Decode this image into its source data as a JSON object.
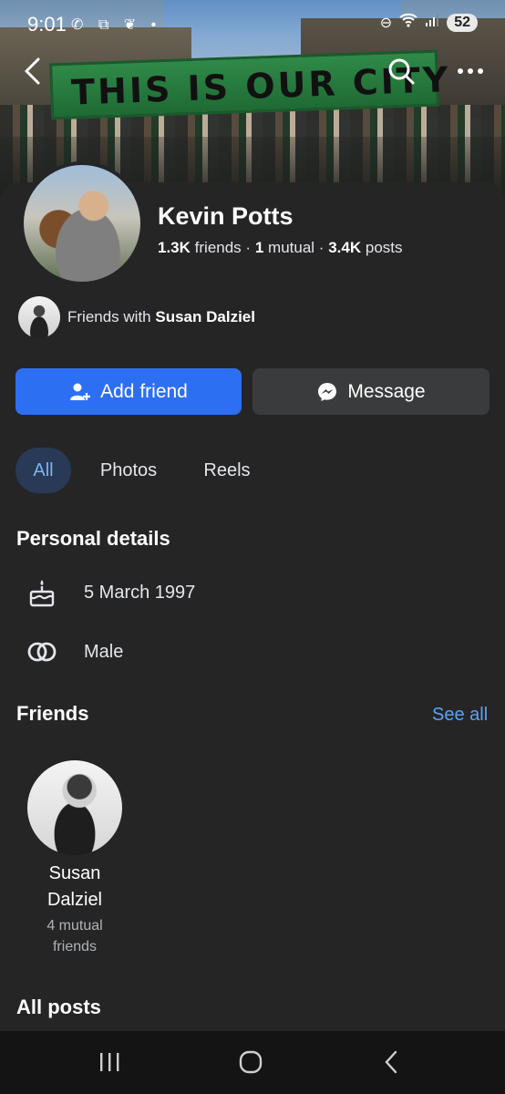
{
  "status_bar": {
    "time": "9:01",
    "battery": "52"
  },
  "cover": {
    "banner_text": "THIS IS OUR CITY"
  },
  "profile": {
    "name": "Kevin Potts",
    "friends_count": "1.3K",
    "friends_word": "friends",
    "mutual_count": "1",
    "mutual_word": "mutual",
    "posts_count": "3.4K",
    "posts_word": "posts",
    "separator": "·"
  },
  "mutual_line": {
    "prefix": "Friends with ",
    "friend": "Susan Dalziel"
  },
  "actions": {
    "add_friend": "Add friend",
    "message": "Message"
  },
  "tabs": [
    {
      "label": "All",
      "active": true
    },
    {
      "label": "Photos"
    },
    {
      "label": "Reels"
    }
  ],
  "personal_details": {
    "heading": "Personal details",
    "birthday": "5 March 1997",
    "gender": "Male"
  },
  "friends_section": {
    "heading": "Friends",
    "see_all": "See all",
    "items": [
      {
        "name": "Susan Dalziel",
        "mutual_line1": "4 mutual",
        "mutual_line2": "friends"
      }
    ]
  },
  "all_posts": {
    "heading": "All posts"
  },
  "colors": {
    "accent": "#2d6ff3",
    "link": "#5aa2f7",
    "background": "#252526"
  }
}
